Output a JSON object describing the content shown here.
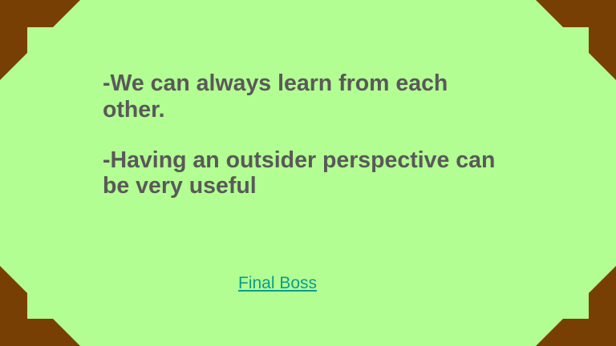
{
  "slide": {
    "bullets": [
      "-We can always learn from each other.",
      "-Having an outsider perspective can be very useful"
    ],
    "link_label": "Final Boss"
  },
  "colors": {
    "background": "#b3fe92",
    "frame": "#783f04",
    "text": "#595959",
    "link": "#0b9c8c"
  }
}
